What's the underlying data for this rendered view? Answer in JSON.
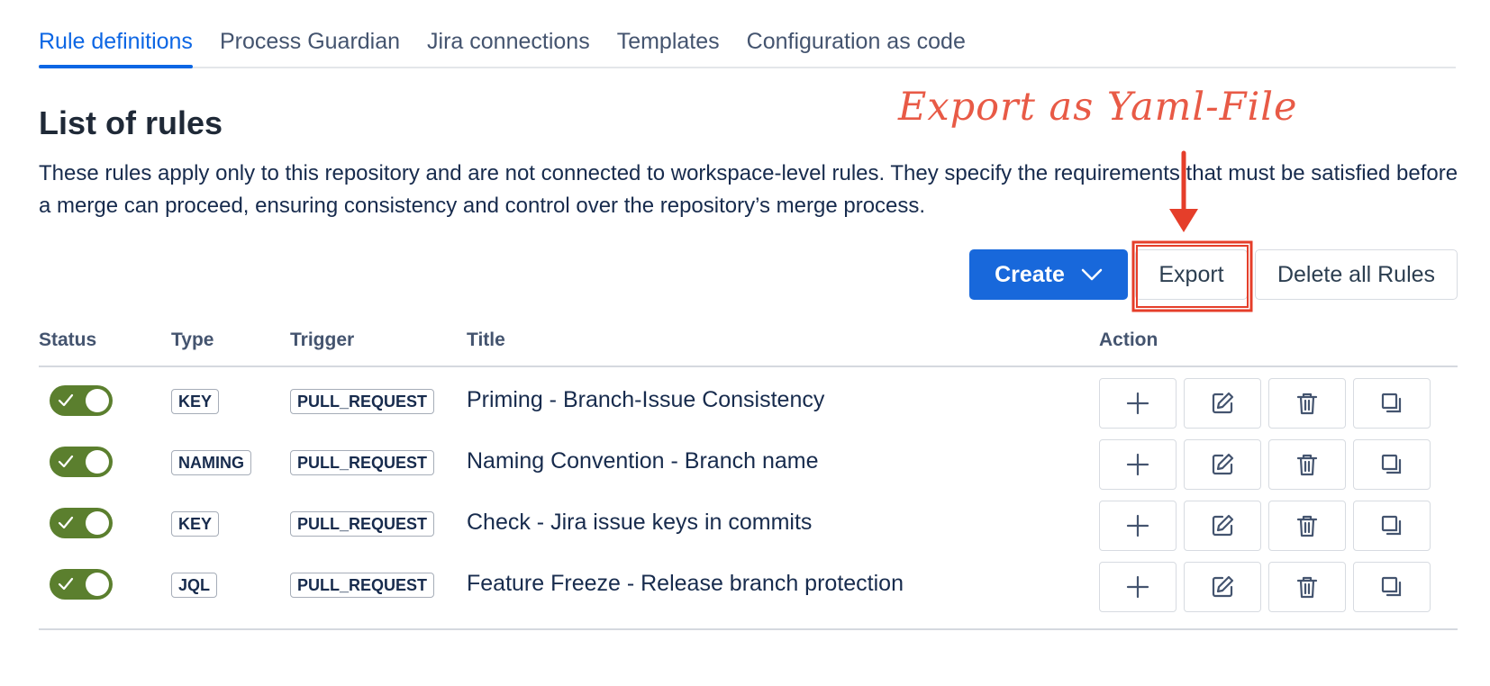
{
  "tabs": [
    {
      "label": "Rule definitions",
      "active": true
    },
    {
      "label": "Process Guardian",
      "active": false
    },
    {
      "label": "Jira connections",
      "active": false
    },
    {
      "label": "Templates",
      "active": false
    },
    {
      "label": "Configuration as code",
      "active": false
    }
  ],
  "page": {
    "title": "List of rules",
    "description": "These rules apply only to this repository and are not connected to workspace-level rules. They specify the requirements that must be satisfied before a merge can proceed, ensuring consistency and control over the repository’s merge process."
  },
  "toolbar": {
    "create_label": "Create",
    "export_label": "Export",
    "delete_all_label": "Delete all Rules"
  },
  "annotation": {
    "text": "Export as Yaml-File",
    "color": "#e53e2a"
  },
  "table": {
    "headers": {
      "status": "Status",
      "type": "Type",
      "trigger": "Trigger",
      "title": "Title",
      "action": "Action"
    },
    "rows": [
      {
        "enabled": true,
        "type": "KEY",
        "trigger": "PULL_REQUEST",
        "title": "Priming - Branch-Issue Consistency"
      },
      {
        "enabled": true,
        "type": "NAMING",
        "trigger": "PULL_REQUEST",
        "title": "Naming Convention - Branch name"
      },
      {
        "enabled": true,
        "type": "KEY",
        "trigger": "PULL_REQUEST",
        "title": "Check - Jira issue keys in commits"
      },
      {
        "enabled": true,
        "type": "JQL",
        "trigger": "PULL_REQUEST",
        "title": "Feature Freeze - Release branch protection"
      }
    ],
    "row_actions": [
      "add-icon",
      "edit-icon",
      "delete-icon",
      "duplicate-icon"
    ]
  },
  "colors": {
    "accent": "#0c66e4",
    "create_button": "#1868db",
    "toggle_on": "#5b7f2e"
  }
}
